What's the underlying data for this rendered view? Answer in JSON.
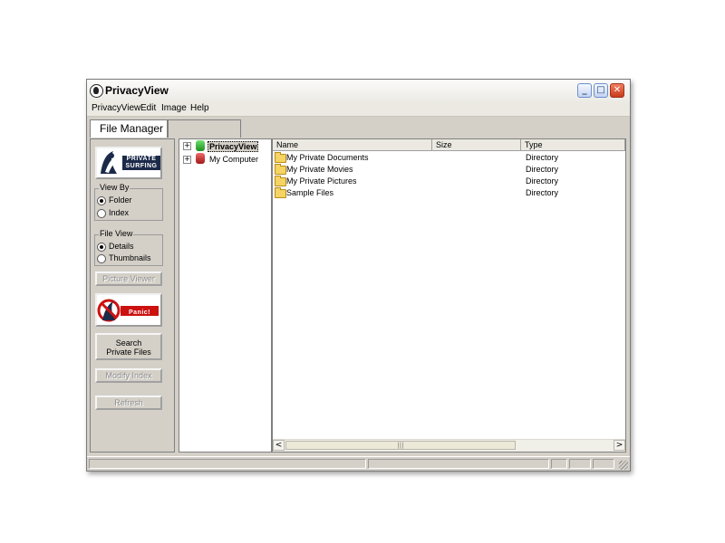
{
  "window": {
    "title": "PrivacyView"
  },
  "titlebar_buttons": {
    "minimize": "_",
    "maximize": "□",
    "close": "✕"
  },
  "menu": [
    "PrivacyView",
    "Edit",
    "Image",
    "Help"
  ],
  "tabs": [
    {
      "label": "File Manager"
    },
    {
      "label": ""
    }
  ],
  "left": {
    "private_surfing_text": "PRIVATE SURFING",
    "view_by": {
      "title": "View By",
      "options": [
        "Folder",
        "Index"
      ],
      "selected": "Folder"
    },
    "file_view": {
      "title": "File View",
      "options": [
        "Details",
        "Thumbnails"
      ],
      "selected": "Details"
    },
    "picture_viewer": "Picture Viewer",
    "panic_text": "Panic!",
    "search_line1": "Search",
    "search_line2": "Private Files",
    "modify_index": "Modify Index",
    "refresh": "Refresh"
  },
  "tree": [
    {
      "label": "PrivacyView",
      "expander": "+",
      "selected": true,
      "icon_color": "#2db52d"
    },
    {
      "label": "My Computer",
      "expander": "+",
      "selected": false,
      "icon_color": "#c62828"
    }
  ],
  "list": {
    "columns": [
      "Name",
      "Size",
      "Type"
    ],
    "rows": [
      {
        "name": "My Private Documents",
        "size": "",
        "type": "Directory"
      },
      {
        "name": "My Private Movies",
        "size": "",
        "type": "Directory"
      },
      {
        "name": "My Private Pictures",
        "size": "",
        "type": "Directory"
      },
      {
        "name": "Sample Files",
        "size": "",
        "type": "Directory"
      }
    ]
  },
  "scrollbar": {
    "left_arrow": "<",
    "right_arrow": ">",
    "thumb_grip": "|||"
  },
  "colors": {
    "window_bg": "#d4d0c8",
    "list_bg": "#ffffff",
    "close_button": "#c73b1b"
  }
}
